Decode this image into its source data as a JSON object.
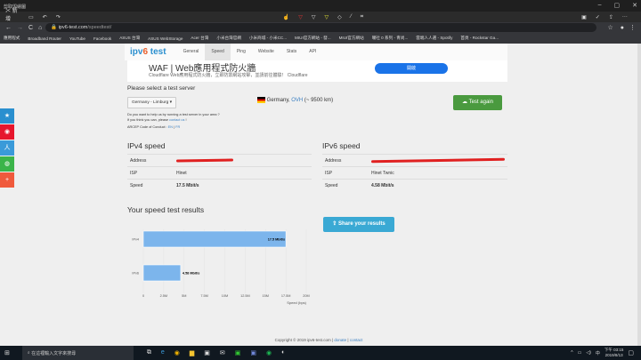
{
  "window": {
    "title": "剪取與繪圖"
  },
  "toolbar": {
    "new_label": "新增"
  },
  "browser": {
    "url_host": "ipv6-test.com",
    "url_path": "/speedtest/"
  },
  "bookmarks": [
    "應用程式",
    "Broadband Router",
    "YouTube",
    "Facebook",
    "ASUS 台灣",
    "ASUS WebStorage",
    "Acer 台灣",
    "小米台灣官網",
    "小米商城 - 小米CC...",
    "MIUI官方網站 - 發...",
    "MIUI官方網站",
    "囉社 0 系列 - 青尚...",
    "雲端人人選 - Spotify",
    "首頁 - Rockstar Ga..."
  ],
  "nav": {
    "logo_a": "ipv",
    "logo_b": "6",
    "logo_c": " test",
    "tabs": [
      "General",
      "Speed",
      "Ping",
      "Website",
      "Stats",
      "API"
    ],
    "active": "Speed"
  },
  "ad": {
    "headline": "WAF | Web應用程式防火牆",
    "sub": "Cloudflare Web應用程式防火牆，立即防禦網站攻擊，並請前往體驗！ Cloudflare",
    "button": "開啟"
  },
  "server": {
    "heading": "Please select a test server",
    "selected": "Germany - Limburg ▾",
    "location_prefix": "Germany, ",
    "location_link": "OVH",
    "location_suffix": " (~ 9500 km)",
    "test_again": "Test again",
    "help1": "Do you want to help us by running a test server in your area ?",
    "help2_prefix": "If you think you can, please ",
    "help2_link": "contact us",
    "help2_suffix": " !",
    "code": "ARCEP Code of Conduct : ",
    "code_en": "EN",
    "code_sep": " | ",
    "code_fr": "FR"
  },
  "ipv4": {
    "title": "IPv4 speed",
    "rows": [
      {
        "k": "Address",
        "v": ""
      },
      {
        "k": "ISP",
        "v": "Hinet"
      },
      {
        "k": "Speed",
        "v": "17.5 Mbit/s"
      }
    ]
  },
  "ipv6": {
    "title": "IPv6 speed",
    "rows": [
      {
        "k": "Address",
        "v": ""
      },
      {
        "k": "ISP",
        "v": "Hinet Twnic"
      },
      {
        "k": "Speed",
        "v": "4.58 Mbit/s"
      }
    ]
  },
  "results": {
    "title": "Your speed test results",
    "share": "Share your results"
  },
  "chart_data": {
    "type": "bar",
    "orientation": "horizontal",
    "categories": [
      "IPv4",
      "IPv6"
    ],
    "values": [
      17.5,
      4.58
    ],
    "value_labels": [
      "17.5 Mbit/s",
      "4.58 Mbit/s"
    ],
    "xlabel": "Speed (bps)",
    "xlim": [
      0,
      20
    ],
    "xticks": [
      "0",
      "2.5M",
      "5M",
      "7.5M",
      "10M",
      "12.5M",
      "15M",
      "17.5M",
      "20M"
    ],
    "bar_color": "#7cb5ec",
    "grid": true
  },
  "footer": {
    "copy": "Copyright © 2019 ipv6-test.com",
    "sep": " | ",
    "donate": "donate",
    "contact": "contact"
  },
  "taskbar": {
    "search": "在這裡輸入文字來搜尋",
    "time": "下午 03:15",
    "date": "2019/8/13",
    "ime": "中"
  }
}
